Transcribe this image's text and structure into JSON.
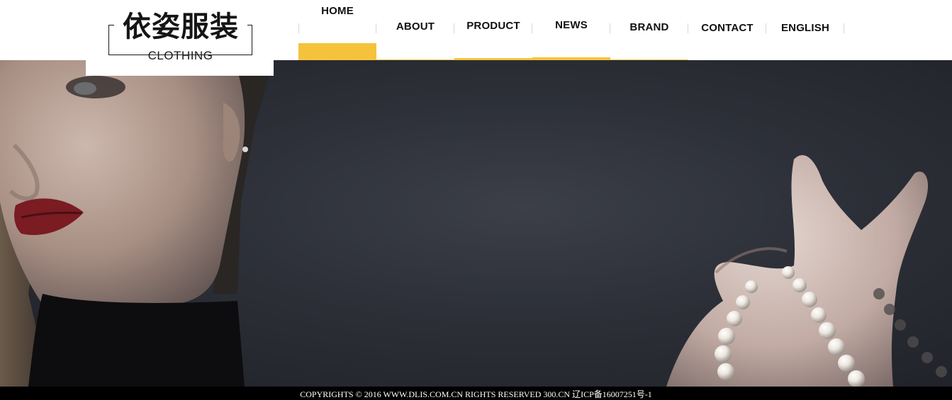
{
  "logo": {
    "cn_text": "依姿服装",
    "en_text": "CLOTHING"
  },
  "nav": {
    "items": [
      {
        "label": "HOME",
        "active": true
      },
      {
        "label": "ABOUT",
        "active": false
      },
      {
        "label": "PRODUCT",
        "active": false
      },
      {
        "label": "NEWS",
        "active": false
      },
      {
        "label": "BRAND",
        "active": false
      },
      {
        "label": "CONTACT",
        "active": false
      },
      {
        "label": "ENGLISH",
        "active": false
      }
    ]
  },
  "colors": {
    "accent": "#f5c33b",
    "banner_bg": "#2c2f37",
    "footer_bg": "#000000"
  },
  "banner": {
    "image": "fashion-model-pearls-photo"
  },
  "footer": {
    "text": "COPYRIGHTS © 2016 WWW.DLIS.COM.CN RIGHTS RESERVED 300.CN 辽ICP备16007251号-1"
  }
}
